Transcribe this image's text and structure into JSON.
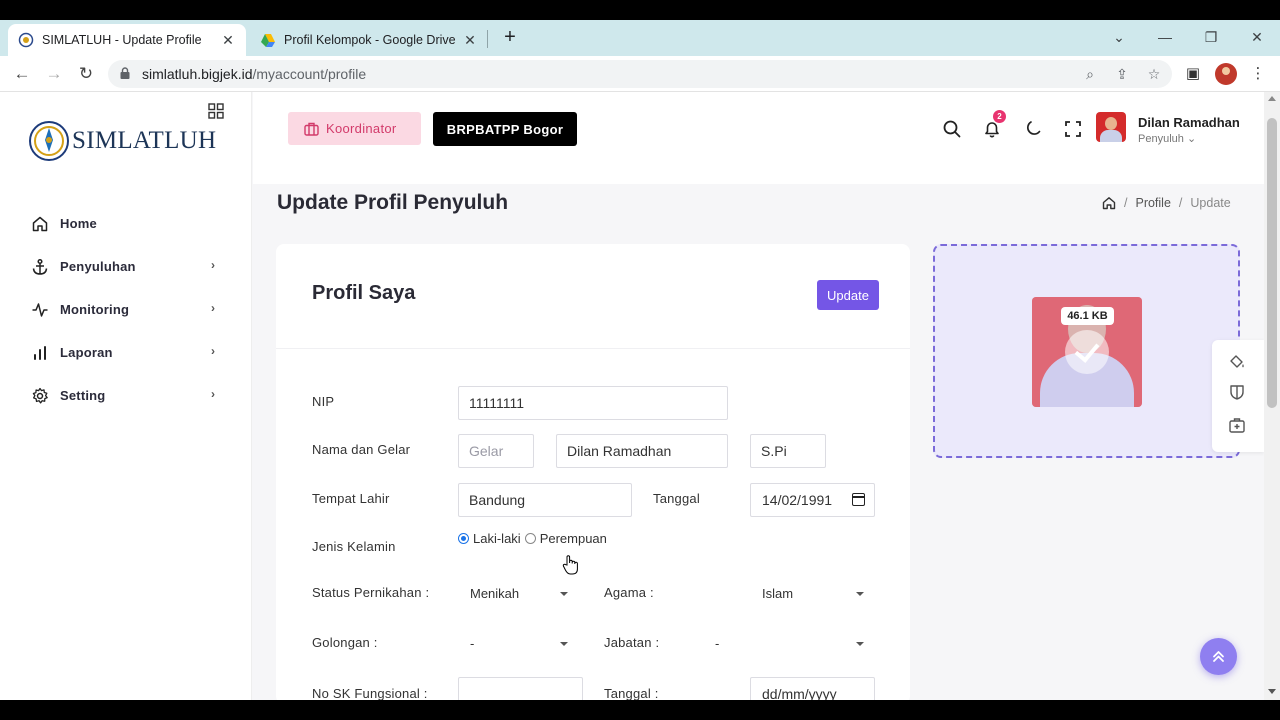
{
  "browser": {
    "tabs": [
      {
        "title": "SIMLATLUH - Update Profile",
        "active": true
      },
      {
        "title": "Profil Kelompok - Google Drive",
        "active": false
      }
    ],
    "url_host": "simlatluh.bigjek.id",
    "url_path": "/myaccount/profile"
  },
  "sidebar": {
    "logo_text": "SIMLATLUH",
    "items": [
      {
        "label": "Home",
        "icon": "home-icon",
        "has_submenu": false
      },
      {
        "label": "Penyuluhan",
        "icon": "anchor-icon",
        "has_submenu": true
      },
      {
        "label": "Monitoring",
        "icon": "activity-icon",
        "has_submenu": true
      },
      {
        "label": "Laporan",
        "icon": "bar-chart-icon",
        "has_submenu": true
      },
      {
        "label": "Setting",
        "icon": "gear-icon",
        "has_submenu": true
      }
    ]
  },
  "topbar": {
    "role_label": "Koordinator",
    "unit_label": "BRPBATPP Bogor",
    "notification_count": "2",
    "user_name": "Dilan Ramadhan",
    "user_role": "Penyuluh"
  },
  "page": {
    "title": "Update Profil Penyuluh",
    "breadcrumb": [
      "Profile",
      "Update"
    ]
  },
  "form": {
    "card_title": "Profil Saya",
    "update_label": "Update",
    "nip_label": "NIP",
    "nip_value": "11111111",
    "nama_label": "Nama dan Gelar",
    "gelar_placeholder": "Gelar",
    "nama_value": "Dilan Ramadhan",
    "gelar_belakang_value": "S.Pi",
    "tempat_lahir_label": "Tempat Lahir",
    "tempat_lahir_value": "Bandung",
    "tanggal_label": "Tanggal",
    "tanggal_value": "14/02/1991",
    "jenis_kelamin_label": "Jenis Kelamin",
    "gender_options": [
      "Laki-laki",
      "Perempuan"
    ],
    "gender_selected": "Laki-laki",
    "status_label": "Status Pernikahan :",
    "status_value": "Menikah",
    "agama_label": "Agama :",
    "agama_value": "Islam",
    "golongan_label": "Golongan :",
    "golongan_value": "-",
    "jabatan_label": "Jabatan :",
    "jabatan_value": "-",
    "sk_label": "No SK Fungsional :",
    "sk_value": "",
    "tanggal_sk_label": "Tanggal :",
    "tanggal_sk_placeholder": "dd/mm/yyyy"
  },
  "photo": {
    "file_size": "46.1 KB"
  },
  "colors": {
    "accent": "#7456e6",
    "role_badge_bg": "#fbd9e3",
    "role_badge_text": "#d23a6a",
    "notification": "#e8336f"
  }
}
